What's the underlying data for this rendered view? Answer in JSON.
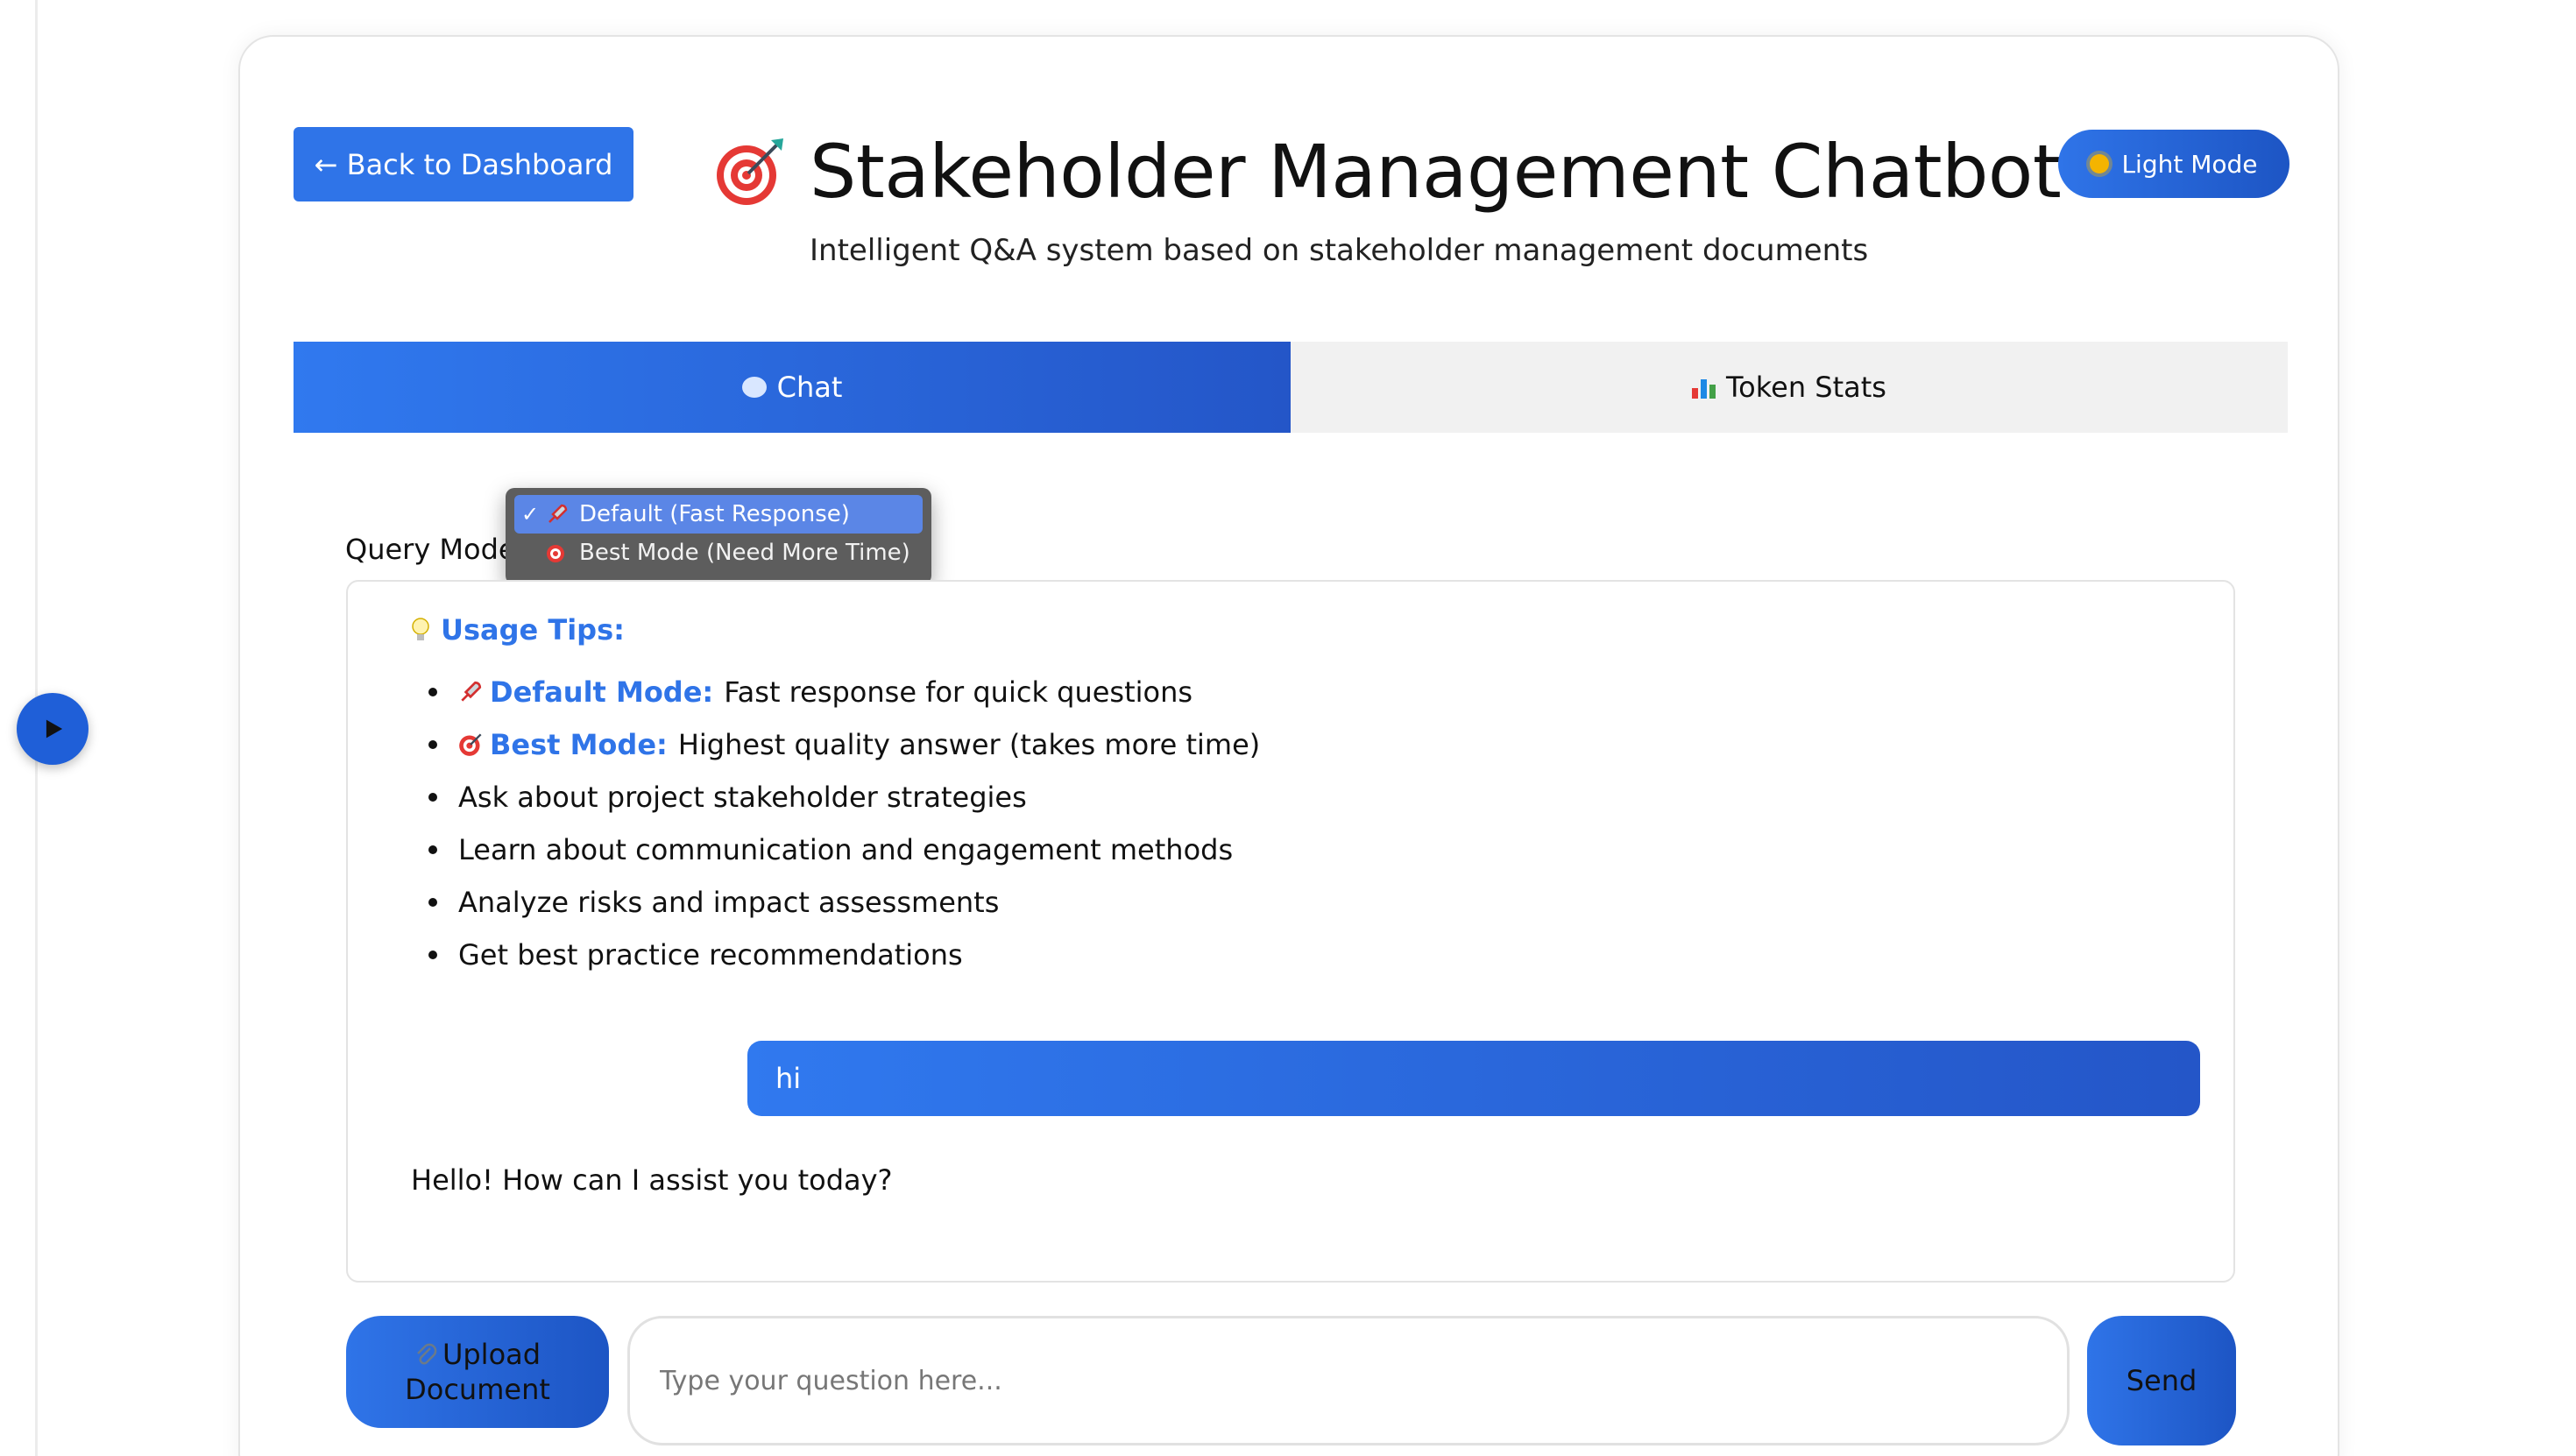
{
  "header": {
    "back_label": "← Back to Dashboard",
    "title": "Stakeholder Management Chatbot",
    "subtitle": "Intelligent Q&A system based on stakeholder management documents",
    "theme_label": "Light Mode",
    "title_icon": "target-icon"
  },
  "tabs": [
    {
      "label": "Chat",
      "icon": "chat-bubble-icon",
      "active": true
    },
    {
      "label": "Token Stats",
      "icon": "bar-chart-icon",
      "active": false
    }
  ],
  "query_mode": {
    "label": "Query Mode:",
    "options": [
      {
        "label": "Default (Fast Response)",
        "icon": "rocket-icon",
        "selected": true
      },
      {
        "label": "Best Mode (Need More Time)",
        "icon": "target-icon",
        "selected": false
      }
    ]
  },
  "tips": {
    "title": "Usage Tips:",
    "items": [
      {
        "strong": "Default Mode:",
        "text": "Fast response for quick questions",
        "icon": "rocket-icon"
      },
      {
        "strong": "Best Mode:",
        "text": "Highest quality answer (takes more time)",
        "icon": "target-icon"
      },
      {
        "text": "Ask about project stakeholder strategies"
      },
      {
        "text": "Learn about communication and engagement methods"
      },
      {
        "text": "Analyze risks and impact assessments"
      },
      {
        "text": "Get best practice recommendations"
      }
    ]
  },
  "messages": {
    "user": "hi",
    "bot": "Hello! How can I assist you today?"
  },
  "composer": {
    "upload_line1": "Upload",
    "upload_line2": "Document",
    "placeholder": "Type your question here...",
    "send_label": "Send"
  },
  "colors": {
    "accent": "#2f74e8",
    "accent_dark": "#1d55c4"
  }
}
